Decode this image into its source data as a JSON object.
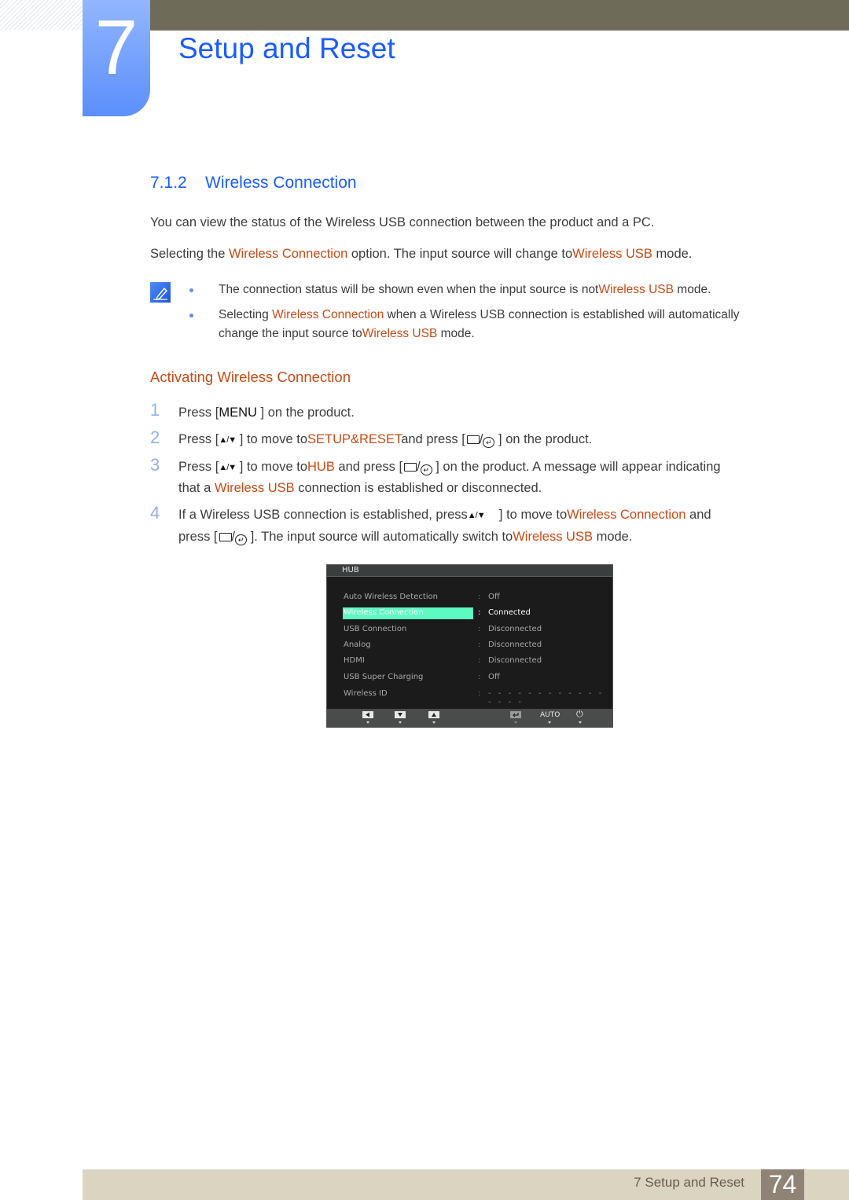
{
  "header": {
    "chapter_number": "7",
    "chapter_title": "Setup and Reset"
  },
  "section": {
    "number": "7.1.2",
    "title": "Wireless Connection"
  },
  "intro": {
    "line1": "You can view the status of the Wireless USB connection between the product and a PC.",
    "line2_parts": [
      "Selecting the ",
      "Wireless Connection",
      " option. The input source will change to",
      "Wireless USB",
      " mode."
    ]
  },
  "notes": {
    "icon": "note-pencil-icon",
    "items": [
      {
        "parts": [
          "The connection status will be shown even when the input source is not",
          "Wireless USB",
          " mode."
        ]
      },
      {
        "parts": [
          "Selecting ",
          "Wireless Connection",
          " when a Wireless USB connection is established will automatically"
        ],
        "line2_parts": [
          "change the input source to",
          "Wireless USB",
          " mode."
        ]
      }
    ]
  },
  "activating": {
    "heading": "Activating Wireless Connection",
    "steps": [
      {
        "num": "1",
        "parts": [
          "Press [",
          "MENU",
          " ] on the product."
        ]
      },
      {
        "num": "2",
        "parts": [
          "Press [",
          "▲/▼",
          " ] to move to",
          "SETUP&RESET",
          "and press [",
          "",
          " ] on the product."
        ]
      },
      {
        "num": "3",
        "parts": [
          "Press [",
          "▲/▼",
          " ] to move to",
          "HUB",
          " and press [",
          "",
          " ] on the product. A message will appear indicating"
        ],
        "line2_parts": [
          "that a ",
          "Wireless USB",
          " connection is established or disconnected."
        ]
      },
      {
        "num": "4",
        "parts": [
          "If a Wireless USB connection is established, press",
          "▲/▼",
          "    ] to move to",
          "Wireless Connection",
          " and"
        ],
        "line2_parts": [
          "press [",
          "",
          " ]. The input source will automatically switch to",
          "Wireless USB",
          " mode."
        ]
      }
    ]
  },
  "osd": {
    "title": "HUB",
    "rows": [
      {
        "label": "Auto Wireless Detection",
        "value": "Off",
        "selected": false
      },
      {
        "label": "Wireless Connection",
        "value": "Connected",
        "selected": true
      },
      {
        "label": "USB Connection",
        "value": "Disconnected",
        "selected": false
      },
      {
        "label": "Analog",
        "value": "Disconnected",
        "selected": false
      },
      {
        "label": "HDMI",
        "value": "Disconnected",
        "selected": false
      },
      {
        "label": "USB Super Charging",
        "value": "Off",
        "selected": false
      },
      {
        "label": "Wireless ID",
        "value": "- - - - - - - - - - - - - - - -",
        "selected": false
      }
    ],
    "colon": ":",
    "footer_buttons": [
      "left-arrow-icon",
      "down-arrow-icon",
      "up-arrow-icon",
      "enter-icon",
      "AUTO",
      "power-icon"
    ],
    "auto_label": "AUTO",
    "selected_color": "#5dfbc1"
  },
  "footer": {
    "text": "7 Setup and Reset",
    "page": "74"
  },
  "colors": {
    "accent_blue": "#1a5cff",
    "highlight_orange": "#c84a14",
    "top_bar": "#6e6c58",
    "footer_bg": "#dad4c1",
    "page_box": "#8f8376"
  }
}
